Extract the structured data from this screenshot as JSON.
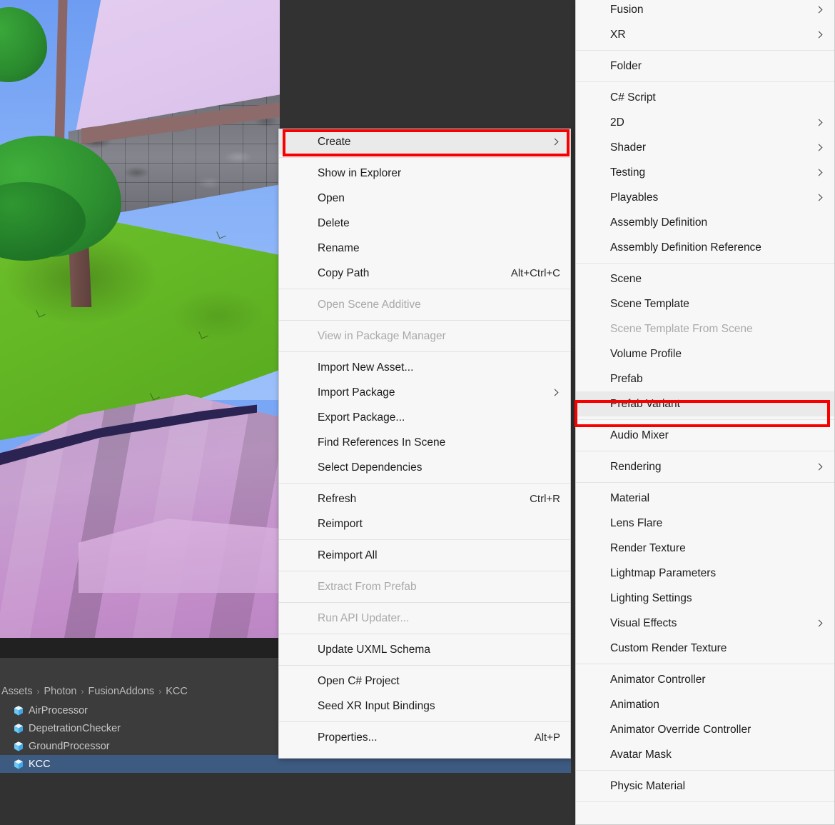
{
  "scene": {
    "description": "low-poly 3D scene with stone wall, trees, grass and water",
    "grass_tuft_icon": "grass-tuft"
  },
  "project_panel": {
    "breadcrumb": [
      {
        "label": "Assets"
      },
      {
        "label": "Photon"
      },
      {
        "label": "FusionAddons"
      },
      {
        "label": "KCC"
      }
    ],
    "breadcrumb_separator": "›",
    "assets": [
      {
        "name": "AirProcessor",
        "icon": "prefab-icon",
        "selected": false
      },
      {
        "name": "DepetrationChecker",
        "icon": "prefab-icon",
        "selected": false
      },
      {
        "name": "GroundProcessor",
        "icon": "prefab-icon",
        "selected": false
      },
      {
        "name": "KCC",
        "icon": "prefab-icon",
        "selected": true
      }
    ],
    "selected_color": "#3d5a80"
  },
  "annotations": {
    "highlight_color": "#f80000",
    "targets": [
      "Create",
      "Prefab Variant"
    ]
  },
  "context_menu": {
    "items": [
      {
        "label": "Create",
        "shortcut": "",
        "submenu": true,
        "disabled": false,
        "highlighted": true
      },
      {
        "separator": false
      },
      {
        "label": "Show in Explorer",
        "shortcut": "",
        "submenu": false,
        "disabled": false
      },
      {
        "label": "Open",
        "shortcut": "",
        "submenu": false,
        "disabled": false
      },
      {
        "label": "Delete",
        "shortcut": "",
        "submenu": false,
        "disabled": false
      },
      {
        "label": "Rename",
        "shortcut": "",
        "submenu": false,
        "disabled": false
      },
      {
        "label": "Copy Path",
        "shortcut": "Alt+Ctrl+C",
        "submenu": false,
        "disabled": false
      },
      {
        "label": "Open Scene Additive",
        "shortcut": "",
        "submenu": false,
        "disabled": true
      },
      {
        "label": "View in Package Manager",
        "shortcut": "",
        "submenu": false,
        "disabled": true
      },
      {
        "label": "Import New Asset...",
        "shortcut": "",
        "submenu": false,
        "disabled": false
      },
      {
        "label": "Import Package",
        "shortcut": "",
        "submenu": true,
        "disabled": false
      },
      {
        "label": "Export Package...",
        "shortcut": "",
        "submenu": false,
        "disabled": false
      },
      {
        "label": "Find References In Scene",
        "shortcut": "",
        "submenu": false,
        "disabled": false
      },
      {
        "label": "Select Dependencies",
        "shortcut": "",
        "submenu": false,
        "disabled": false
      },
      {
        "label": "Refresh",
        "shortcut": "Ctrl+R",
        "submenu": false,
        "disabled": false
      },
      {
        "label": "Reimport",
        "shortcut": "",
        "submenu": false,
        "disabled": false
      },
      {
        "label": "Reimport All",
        "shortcut": "",
        "submenu": false,
        "disabled": false
      },
      {
        "label": "Extract From Prefab",
        "shortcut": "",
        "submenu": false,
        "disabled": true
      },
      {
        "label": "Run API Updater...",
        "shortcut": "",
        "submenu": false,
        "disabled": true
      },
      {
        "label": "Update UXML Schema",
        "shortcut": "",
        "submenu": false,
        "disabled": false
      },
      {
        "label": "Open C# Project",
        "shortcut": "",
        "submenu": false,
        "disabled": false
      },
      {
        "label": "Seed XR Input Bindings",
        "shortcut": "",
        "submenu": false,
        "disabled": false
      },
      {
        "label": "Properties...",
        "shortcut": "Alt+P",
        "submenu": false,
        "disabled": false
      }
    ]
  },
  "create_submenu": {
    "items": [
      {
        "label": "Fusion",
        "submenu": true,
        "disabled": false
      },
      {
        "label": "XR",
        "submenu": true,
        "disabled": false
      },
      {
        "label": "Folder",
        "submenu": false,
        "disabled": false
      },
      {
        "label": "C# Script",
        "submenu": false,
        "disabled": false
      },
      {
        "label": "2D",
        "submenu": true,
        "disabled": false
      },
      {
        "label": "Shader",
        "submenu": true,
        "disabled": false
      },
      {
        "label": "Testing",
        "submenu": true,
        "disabled": false
      },
      {
        "label": "Playables",
        "submenu": true,
        "disabled": false
      },
      {
        "label": "Assembly Definition",
        "submenu": false,
        "disabled": false
      },
      {
        "label": "Assembly Definition Reference",
        "submenu": false,
        "disabled": false
      },
      {
        "label": "Scene",
        "submenu": false,
        "disabled": false
      },
      {
        "label": "Scene Template",
        "submenu": false,
        "disabled": false
      },
      {
        "label": "Scene Template From Scene",
        "submenu": false,
        "disabled": true
      },
      {
        "label": "Volume Profile",
        "submenu": false,
        "disabled": false
      },
      {
        "label": "Prefab",
        "submenu": false,
        "disabled": false
      },
      {
        "label": "Prefab Variant",
        "submenu": false,
        "disabled": false,
        "highlighted": true
      },
      {
        "label": "Audio Mixer",
        "submenu": false,
        "disabled": false
      },
      {
        "label": "Rendering",
        "submenu": true,
        "disabled": false
      },
      {
        "label": "Material",
        "submenu": false,
        "disabled": false
      },
      {
        "label": "Lens Flare",
        "submenu": false,
        "disabled": false
      },
      {
        "label": "Render Texture",
        "submenu": false,
        "disabled": false
      },
      {
        "label": "Lightmap Parameters",
        "submenu": false,
        "disabled": false
      },
      {
        "label": "Lighting Settings",
        "submenu": false,
        "disabled": false
      },
      {
        "label": "Visual Effects",
        "submenu": true,
        "disabled": false
      },
      {
        "label": "Custom Render Texture",
        "submenu": false,
        "disabled": false
      },
      {
        "label": "Animator Controller",
        "submenu": false,
        "disabled": false
      },
      {
        "label": "Animation",
        "submenu": false,
        "disabled": false
      },
      {
        "label": "Animator Override Controller",
        "submenu": false,
        "disabled": false
      },
      {
        "label": "Avatar Mask",
        "submenu": false,
        "disabled": false
      },
      {
        "label": "Physic Material",
        "submenu": false,
        "disabled": false
      }
    ]
  }
}
